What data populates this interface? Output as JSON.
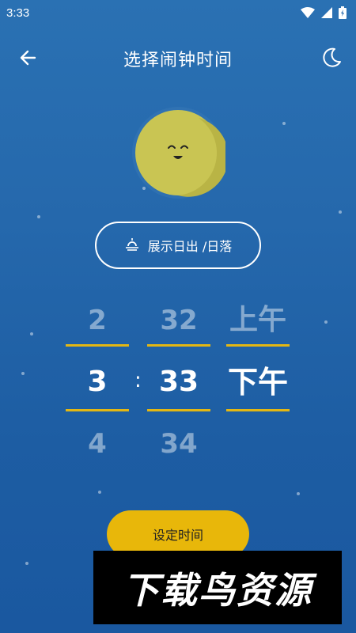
{
  "status_bar": {
    "time": "3:33",
    "icons": [
      "wifi-icon",
      "signal-icon",
      "battery-icon"
    ]
  },
  "app_bar": {
    "title": "选择闹钟时间",
    "back_icon": "arrow-left-icon",
    "theme_icon": "moon-icon"
  },
  "sun_toggle": {
    "icon": "sunrise-icon",
    "label": "展示日出 /日落"
  },
  "picker": {
    "hours": {
      "prev": "2",
      "current": "3",
      "next": "4"
    },
    "separator": ":",
    "minutes": {
      "prev": "32",
      "current": "33",
      "next": "34"
    },
    "ampm": {
      "prev": "上午",
      "current": "下午"
    }
  },
  "set_button": {
    "label": "设定时间"
  },
  "watermark": {
    "text": "下载鸟资源"
  },
  "colors": {
    "background": "#2568ac",
    "accent": "#e8b70a",
    "divider": "#e3b714"
  }
}
